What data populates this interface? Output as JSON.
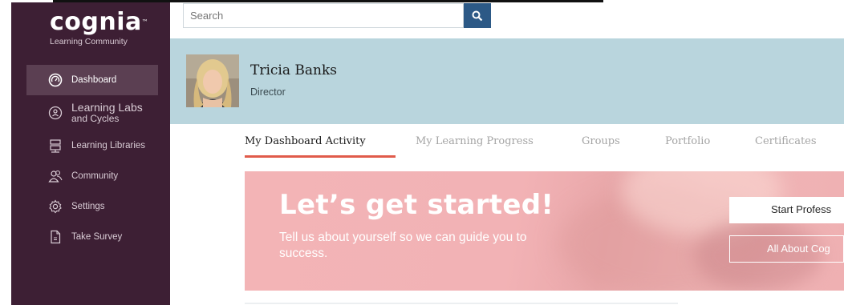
{
  "logo": {
    "word": "cognia",
    "trademark": "™",
    "subtitle": "Learning Community"
  },
  "sidebar": {
    "items": [
      {
        "label": "Dashboard",
        "icon": "dashboard-gauge-icon",
        "active": true
      },
      {
        "label": "Learning Labs",
        "sublabel": "and Cycles",
        "icon": "learning-labs-icon"
      },
      {
        "label": "Learning Libraries",
        "icon": "library-icon"
      },
      {
        "label": "Community",
        "icon": "community-icon"
      },
      {
        "label": "Settings",
        "icon": "gear-icon"
      },
      {
        "label": "Take Survey",
        "icon": "document-icon"
      }
    ]
  },
  "search": {
    "placeholder": "Search",
    "icon": "search-icon"
  },
  "profile": {
    "name": "Tricia Banks",
    "role": "Director"
  },
  "tabs": [
    {
      "label": "My Dashboard Activity",
      "active": true
    },
    {
      "label": "My Learning Progress"
    },
    {
      "label": "Groups"
    },
    {
      "label": "Portfolio"
    },
    {
      "label": "Certificates"
    }
  ],
  "banner": {
    "title": "Let’s get started!",
    "text": "Tell us about yourself so we can guide you to success.",
    "button_primary": "Start Profess",
    "button_secondary": "All About Cog"
  },
  "colors": {
    "sidebar_bg": "#3d1f34",
    "sidebar_active": "#5b3f52",
    "profile_bg": "#b9d5dd",
    "search_button": "#2c5986",
    "tab_underline": "#e05b4b",
    "banner_bg": "#f3b4b6"
  }
}
